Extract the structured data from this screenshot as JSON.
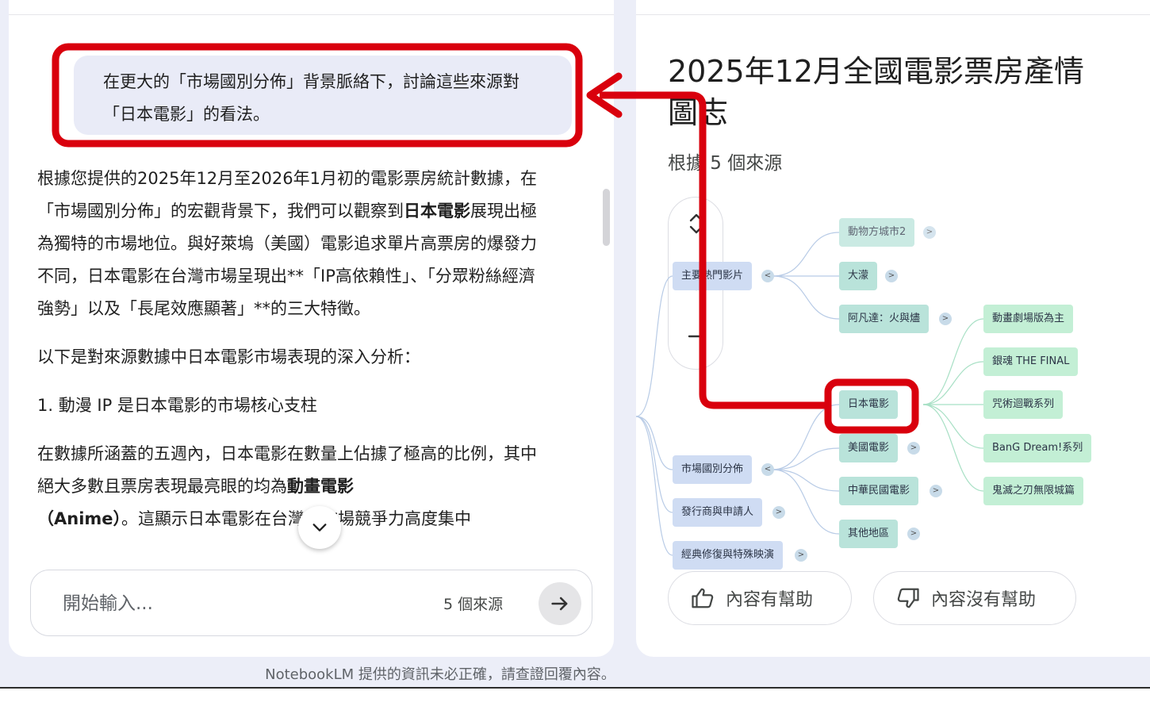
{
  "chat": {
    "query": "在更大的「市場國別分佈」背景脈絡下，討論這些來源對「日本電影」的看法。",
    "response": {
      "p1_a": "根據您提供的2025年12月至2026年1月初的電影票房統計數據，在「市場國別分佈」的宏觀背景下，我們可以觀察到",
      "p1_bold": "日本電影",
      "p1_b": "展現出極為獨特的市場地位。與好萊塢（美國）電影追求單片高票房的爆發力不同，日本電影在台灣市場呈現出**「IP高依賴性」、「分眾粉絲經濟強勢」以及「長尾效應顯著」**的三大特徵。",
      "p2": "以下是對來源數據中日本電影市場表現的深入分析：",
      "h1": "1. 動漫 IP 是日本電影的市場核心支柱",
      "p3_a": "在數據所涵蓋的五週內，日本電影在數量上佔據了極高的比例，其中絕大多數且票房表現最亮眼的均為",
      "p3_bold": "動畫電影",
      "p3_bold2": "（Anime）",
      "p3_b": "。這顯示日本電影在台灣的市場競爭力高度集中"
    },
    "input_placeholder": "開始輸入...",
    "source_count": "5 個來源"
  },
  "studio": {
    "title": "2025年12月全國電影票房產情圖志",
    "subtitle": "根據 5 個來源",
    "mindmap": {
      "level1": [
        "主要熱門影片",
        "市場國別分佈",
        "發行商與申請人",
        "經典修復與特殊映演"
      ],
      "hot_films": [
        "動物方城市2",
        "大濛",
        "阿凡達：火與燼"
      ],
      "countries": [
        "日本電影",
        "美國電影",
        "中華民國電影",
        "其他地區"
      ],
      "japan_films": [
        "動畫劇場版為主",
        "銀魂 THE FINAL",
        "咒術迴戰系列",
        "BanG Dream!系列",
        "鬼滅之刃無限城篇"
      ]
    },
    "feedback_good": "內容有幫助",
    "feedback_bad": "內容沒有幫助"
  },
  "footer": {
    "disclaimer": "NotebookLM 提供的資訊未必正確，請查證回覆內容。"
  },
  "colors": {
    "annotation": "#d9000d",
    "node_blue": "#cfdcf3",
    "node_teal": "#b9e3da",
    "node_green": "#c3efd5"
  }
}
